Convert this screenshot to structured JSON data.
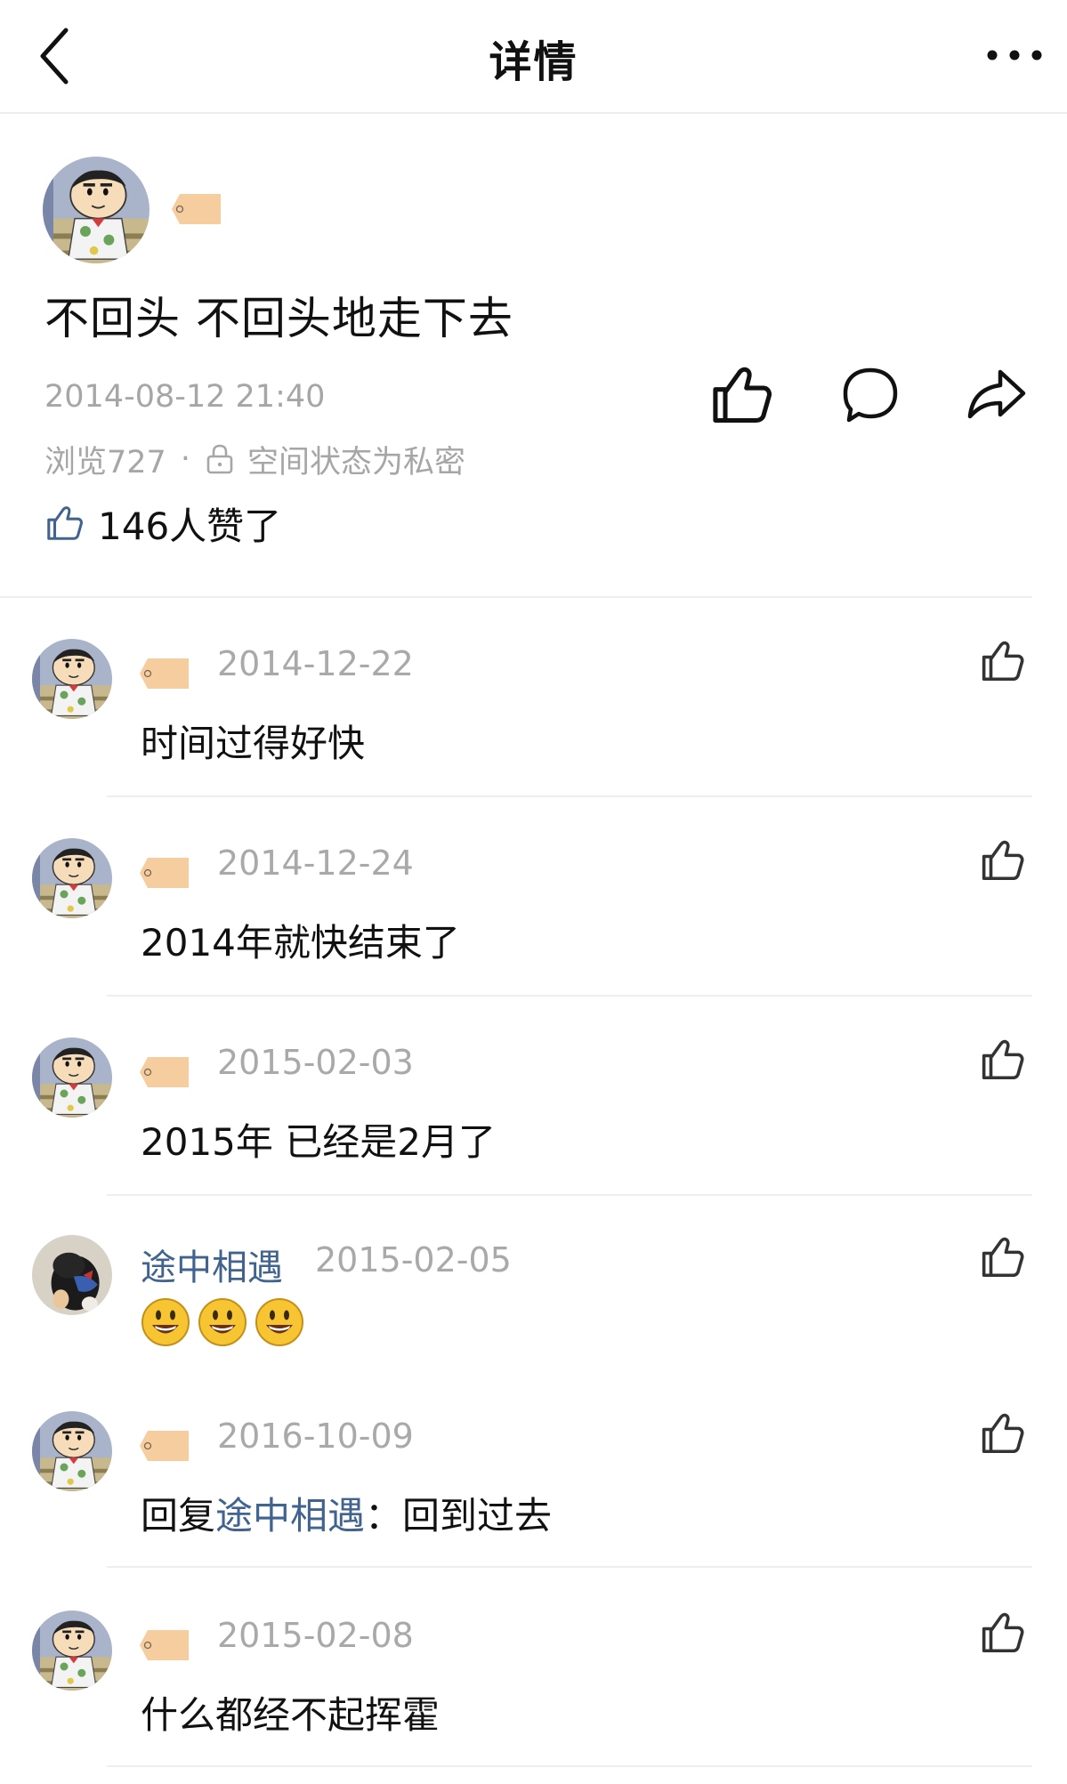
{
  "header": {
    "title": "详情",
    "back_icon": "chevron-left-icon",
    "more_icon": "more-dots-icon"
  },
  "post": {
    "text": "不回头 不回头地走下去",
    "time": "2014-08-12 21:40",
    "views": "浏览727",
    "separator": "·",
    "privacy": "空间状态为私密",
    "likes": "146人赞了",
    "actions": [
      "like-icon",
      "comment-icon",
      "share-icon"
    ]
  },
  "comments": [
    {
      "date": "2014-12-22",
      "text": "时间过得好快"
    },
    {
      "date": "2014-12-24",
      "text": "2014年就快结束了"
    },
    {
      "date": "2015-02-03",
      "text": "2015年 已经是2月了"
    },
    {
      "name": "途中相遇",
      "date": "2015-02-05",
      "emoji": [
        "😃",
        "😃",
        "😃"
      ]
    },
    {
      "date": "2016-10-09",
      "reply_prefix": "回复",
      "reply_to": "途中相遇",
      "reply_suffix": "：回到过去"
    },
    {
      "date": "2015-02-08",
      "text": "什么都经不起挥霍"
    }
  ],
  "colors": {
    "link": "#40638f",
    "meta": "#a6a6a6",
    "tag": "#f6cd9f"
  }
}
